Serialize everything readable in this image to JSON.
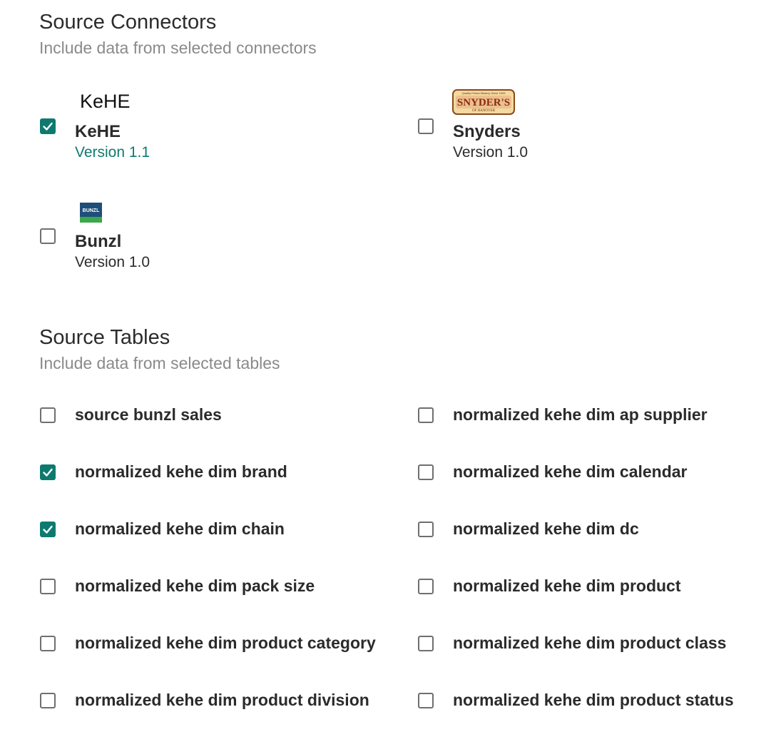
{
  "connectors_section": {
    "title": "Source Connectors",
    "subtitle": "Include data from selected connectors"
  },
  "connectors": [
    {
      "logo_text": "KeHE",
      "logo_icon": "kehe-logo",
      "name": "KeHE",
      "version": "Version 1.1",
      "checked": true
    },
    {
      "logo_text": "SNYDER'S",
      "logo_subtext": "OF HANOVER",
      "logo_icon": "snyders-logo",
      "name": "Snyders",
      "version": "Version 1.0",
      "checked": false
    },
    {
      "logo_text": "BUNZL",
      "logo_icon": "bunzl-logo",
      "name": "Bunzl",
      "version": "Version 1.0",
      "checked": false
    }
  ],
  "tables_section": {
    "title": "Source Tables",
    "subtitle": "Include data from selected tables"
  },
  "tables": [
    {
      "label": "source bunzl sales",
      "checked": false
    },
    {
      "label": "normalized kehe dim ap supplier",
      "checked": false
    },
    {
      "label": "normalized kehe dim brand",
      "checked": true
    },
    {
      "label": "normalized kehe dim calendar",
      "checked": false
    },
    {
      "label": "normalized kehe dim chain",
      "checked": true
    },
    {
      "label": "normalized kehe dim dc",
      "checked": false
    },
    {
      "label": "normalized kehe dim pack size",
      "checked": false
    },
    {
      "label": "normalized kehe dim product",
      "checked": false
    },
    {
      "label": "normalized kehe dim product category",
      "checked": false
    },
    {
      "label": "normalized kehe dim product class",
      "checked": false
    },
    {
      "label": "normalized kehe dim product division",
      "checked": false
    },
    {
      "label": "normalized kehe dim product status",
      "checked": false
    }
  ],
  "colors": {
    "accent": "#0e7a6f",
    "text": "#2b2b2b",
    "muted": "#8a8a8a"
  }
}
